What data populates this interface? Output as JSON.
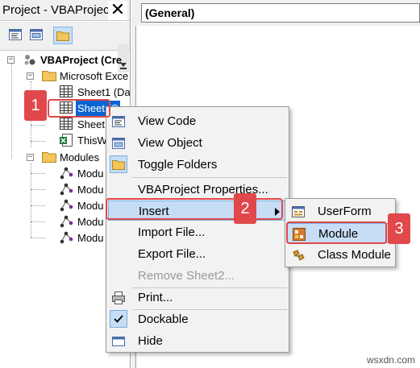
{
  "project_pane": {
    "title": "Project - VBAProject",
    "close_glyph": "✕",
    "toolbar": [
      "view-code-icon",
      "view-object-icon",
      "toggle-folders-icon"
    ],
    "tree": {
      "root": "VBAProject (Cre",
      "objects_folder": "Microsoft Exce",
      "sheet1": "Sheet1 (Da",
      "sheet2": "Sheet",
      "sheet2_tail": "(S",
      "sheet3": "Sheet",
      "this_workbook": "ThisW",
      "modules_folder": "Modules",
      "modules": [
        "Modu",
        "Modu",
        "Modu",
        "Modu",
        "Modu"
      ]
    }
  },
  "code_pane": {
    "object_combo": "(General)"
  },
  "context_menu": {
    "items": [
      {
        "label": "View Code",
        "icon": "view-code-icon"
      },
      {
        "label": "View Object",
        "icon": "view-object-icon"
      },
      {
        "label": "Toggle Folders",
        "icon": "folder-icon"
      },
      {
        "label": "VBAProject Properties...",
        "icon": ""
      },
      {
        "label": "Insert",
        "icon": "",
        "has_submenu": true,
        "highlighted": true
      },
      {
        "label": "Import File...",
        "icon": ""
      },
      {
        "label": "Export File...",
        "icon": ""
      },
      {
        "label": "Remove Sheet2...",
        "icon": "",
        "disabled": true
      },
      {
        "label": "Print...",
        "icon": "printer-icon"
      },
      {
        "label": "Dockable",
        "icon": "checkmark-icon",
        "checked": true
      },
      {
        "label": "Hide",
        "icon": "hide-icon"
      }
    ]
  },
  "insert_submenu": {
    "items": [
      {
        "label": "UserForm",
        "icon": "userform-icon"
      },
      {
        "label": "Module",
        "icon": "module-icon",
        "highlighted": true
      },
      {
        "label": "Class Module",
        "icon": "class-module-icon"
      }
    ]
  },
  "annotations": {
    "step1": "1",
    "step2": "2",
    "step3": "3",
    "color": "#e0484b"
  },
  "watermark": "wsxdn.com",
  "colors": {
    "selection": "#0a64d2",
    "menu_highlight": "#c6ddf5",
    "menu_background": "#f2f2f2"
  }
}
